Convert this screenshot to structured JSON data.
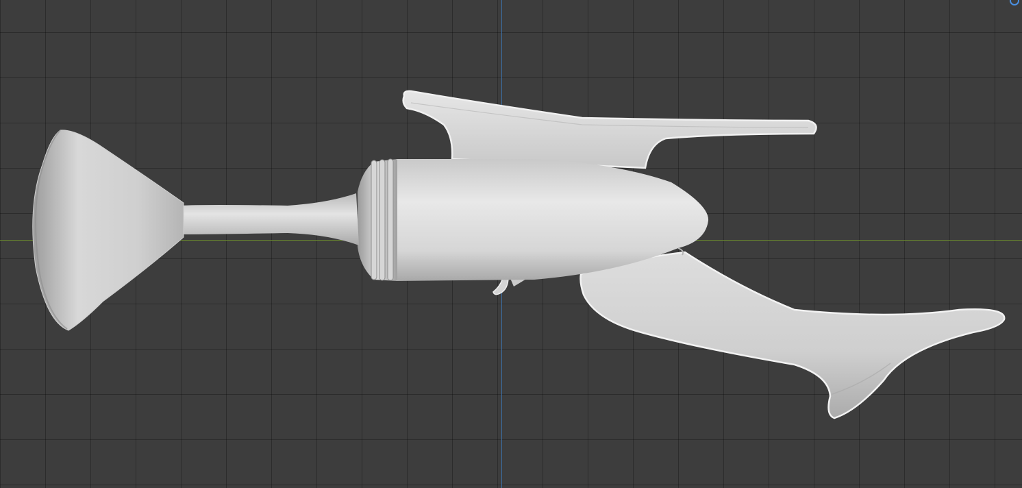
{
  "viewport": {
    "background_color": "#3d3d3d",
    "grid_line_color": "#2f2f2f",
    "x_axis_color": "#6a8a2e",
    "z_axis_color": "#3d6fa5"
  },
  "model": {
    "name": "raygun",
    "material_color": "#dcdcdc",
    "shadow_color": "#9a9a9a",
    "outline_color": "#f2f2f2"
  },
  "navigation_gizmo": {
    "icon": "view-orientation-icon",
    "color": "#4a90e2"
  }
}
